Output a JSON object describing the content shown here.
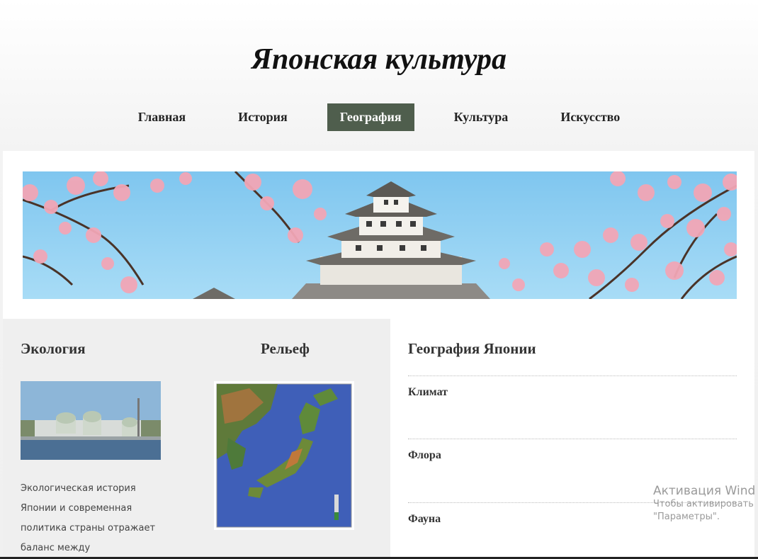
{
  "site": {
    "title": "Японская культура"
  },
  "nav": {
    "items": [
      {
        "label": "Главная"
      },
      {
        "label": "История"
      },
      {
        "label": "География"
      },
      {
        "label": "Культура"
      },
      {
        "label": "Искусство"
      }
    ],
    "active_index": 2
  },
  "banner": {
    "description_icon": "castle-sakura-banner"
  },
  "ecology": {
    "heading": "Экология",
    "text_lines": [
      "Экологическая история",
      "Японии и современная",
      "политика страны отражает",
      "баланс между"
    ]
  },
  "relief": {
    "heading": "Рельеф"
  },
  "geography": {
    "heading": "География Японии",
    "sections": [
      "Климат",
      "Флора",
      "Фауна"
    ]
  },
  "watermark": {
    "title": "Активация Wind",
    "line1": "Чтобы активировать",
    "line2": "\"Параметры\"."
  },
  "colors": {
    "nav_active_bg": "#4f5e4d",
    "panel_bg": "#efefef"
  }
}
